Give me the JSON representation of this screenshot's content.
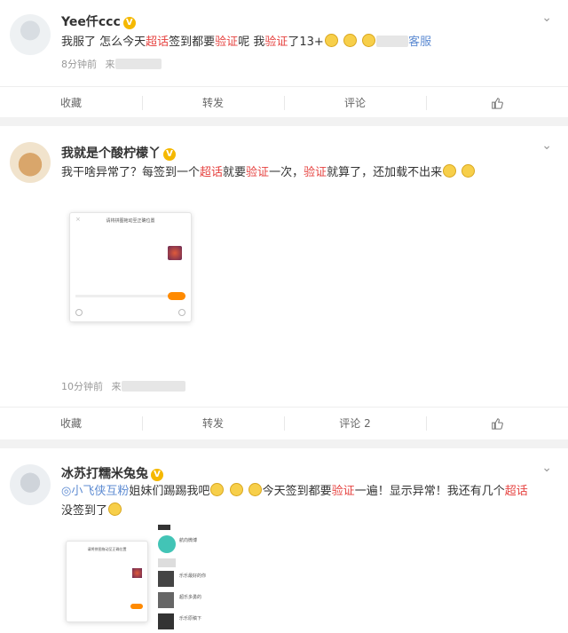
{
  "posts": [
    {
      "user": "Yee仟ccc",
      "text": [
        {
          "t": "我服了 怎么今天",
          "c": ""
        },
        {
          "t": "超话",
          "c": "hl"
        },
        {
          "t": "签到都要",
          "c": ""
        },
        {
          "t": "验证",
          "c": "hl"
        },
        {
          "t": "呢 我",
          "c": ""
        },
        {
          "t": "验证",
          "c": "hl"
        },
        {
          "t": "了13+",
          "c": ""
        }
      ],
      "link_tail": "客服",
      "time": "8分钟前",
      "source_prefix": "来",
      "actions": {
        "collect": "收藏",
        "repost": "转发",
        "comment": "评论"
      }
    },
    {
      "user": "我就是个酸柠檬丫",
      "text": [
        {
          "t": "我干啥异常了？每签到一个",
          "c": ""
        },
        {
          "t": "超话",
          "c": "hl"
        },
        {
          "t": "就要",
          "c": ""
        },
        {
          "t": "验证",
          "c": "hl"
        },
        {
          "t": "一次，",
          "c": ""
        },
        {
          "t": "验证",
          "c": "hl"
        },
        {
          "t": "就算了，还加载不出来",
          "c": ""
        }
      ],
      "dialog_title": "请将拼图拖动至正确位置",
      "time": "10分钟前",
      "source_prefix": "来",
      "actions": {
        "collect": "收藏",
        "repost": "转发",
        "comment": "评论 2"
      }
    },
    {
      "user": "冰苏打糯米兔兔",
      "topic": "小飞侠互粉",
      "line1": [
        {
          "t": "姐妹们踢踢我吧",
          "c": ""
        }
      ],
      "line1b": [
        {
          "t": "今天签到都要",
          "c": ""
        },
        {
          "t": "验证",
          "c": "hl"
        },
        {
          "t": "一遍！显示异常！我还有几个",
          "c": ""
        },
        {
          "t": "超话",
          "c": "hl"
        }
      ],
      "line2": "没签到了",
      "dialog_title": "请将拼图拖动至正确位置",
      "list_items": [
        "航向微博",
        "",
        "乐乐最好的你",
        "超乐多勇的",
        "乐乐原稿下"
      ]
    }
  ],
  "colors": {
    "highlight": "#e64340",
    "link": "#5d8bd2",
    "badge": "#f5b800",
    "button": "#ff8a00"
  }
}
